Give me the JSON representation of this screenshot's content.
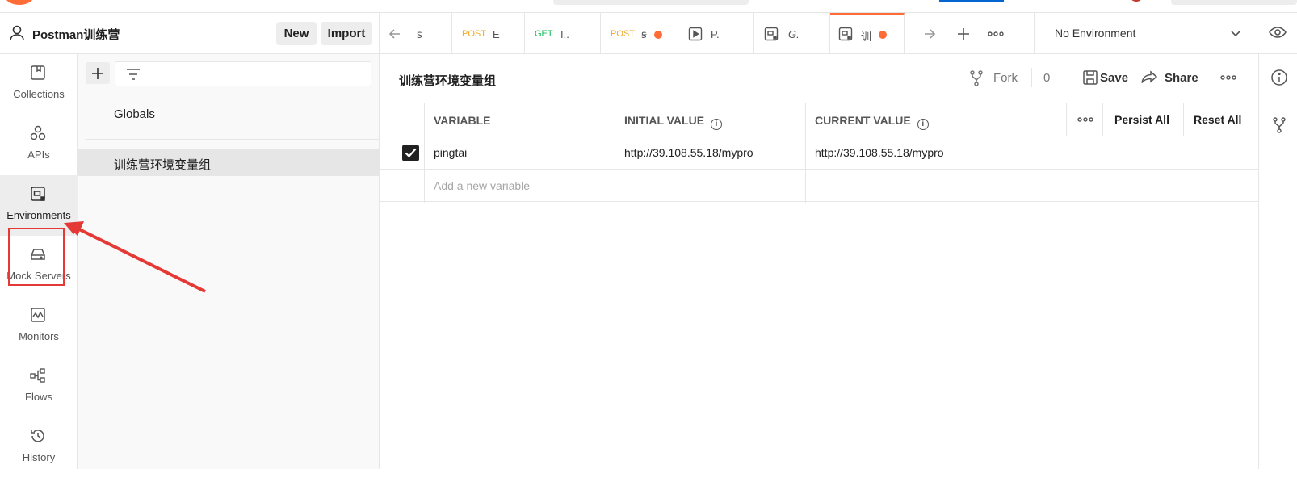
{
  "workspace": {
    "name": "Postman训练营",
    "new_label": "New",
    "import_label": "Import"
  },
  "tabs": [
    {
      "method": "",
      "title": "ꜱ",
      "method_color": "#a6a6a6"
    },
    {
      "method": "POST",
      "title": "E",
      "method_color": "#f5a623"
    },
    {
      "method": "GET",
      "title": "I..",
      "method_color": "#0cbb52"
    },
    {
      "method": "POST",
      "title": "ꞩ",
      "method_color": "#f5a623"
    },
    {
      "method": "",
      "title": "P.",
      "icon": "runner-icon"
    },
    {
      "method": "",
      "title": "G.",
      "icon": "environment-icon"
    },
    {
      "method": "",
      "title": "训",
      "icon": "environment-icon"
    }
  ],
  "environment_selector": {
    "value": "No Environment"
  },
  "leftnav": [
    {
      "label": "Collections",
      "icon": "collections-icon"
    },
    {
      "label": "APIs",
      "icon": "apis-icon"
    },
    {
      "label": "Environments",
      "icon": "environments-icon"
    },
    {
      "label": "Mock Servers",
      "icon": "mock-servers-icon"
    },
    {
      "label": "Monitors",
      "icon": "monitors-icon"
    },
    {
      "label": "Flows",
      "icon": "flows-icon"
    },
    {
      "label": "History",
      "icon": "history-icon"
    }
  ],
  "sidebar": {
    "items": [
      {
        "label": "Globals"
      },
      {
        "label": "训练营环境变量组"
      }
    ]
  },
  "editor": {
    "title": "训练营环境变量组",
    "fork_label": "Fork",
    "fork_count": "0",
    "save_label": "Save",
    "share_label": "Share",
    "columns": {
      "variable": "VARIABLE",
      "initial_value": "INITIAL VALUE",
      "current_value": "CURRENT VALUE",
      "persist_all": "Persist All",
      "reset_all": "Reset All"
    },
    "rows": [
      {
        "enabled": true,
        "variable": "pingtai",
        "initial_value": "http://39.108.55.18/mypro",
        "current_value": "http://39.108.55.18/mypro"
      }
    ],
    "new_variable_placeholder": "Add a new variable"
  },
  "colors": {
    "accent": "#ff6c37",
    "annotation": "#e53935"
  }
}
